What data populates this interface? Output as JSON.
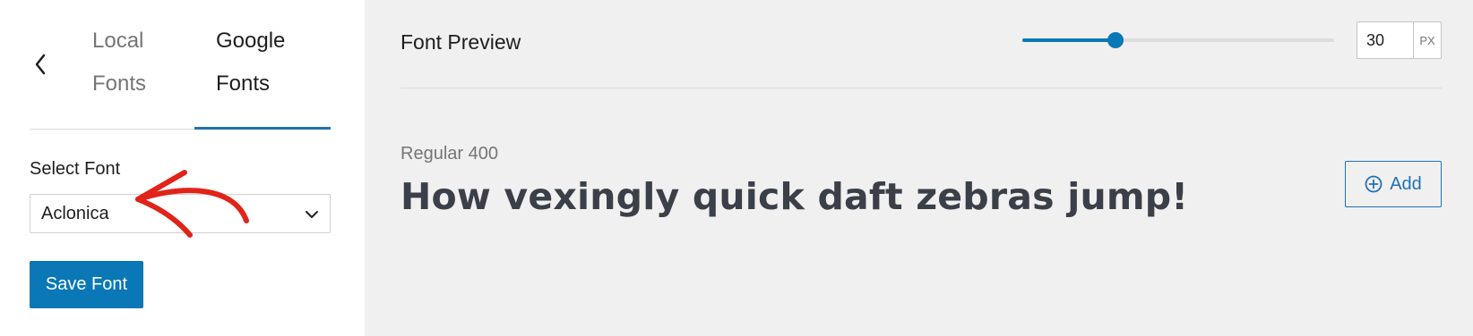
{
  "sidebar": {
    "tabs": [
      {
        "label_line1": "Local",
        "label_line2": "Fonts",
        "active": false
      },
      {
        "label_line1": "Google",
        "label_line2": "Fonts",
        "active": true
      }
    ],
    "select_label": "Select Font",
    "selected_font": "Aclonica",
    "save_label": "Save Font"
  },
  "preview": {
    "title": "Font Preview",
    "size_value": "30",
    "size_unit": "PX",
    "size_slider_fraction": 0.3,
    "weight_label": "Regular 400",
    "sample_text": "How vexingly quick daft zebras jump!",
    "add_label": "Add"
  },
  "colors": {
    "accent": "#0a77b6",
    "annotation": "#e2231a",
    "preview_bg": "#f0f0f0"
  },
  "icons": [
    "chevron-left-icon",
    "chevron-down-icon",
    "red-arrow-annotation",
    "plus-circle-icon"
  ]
}
